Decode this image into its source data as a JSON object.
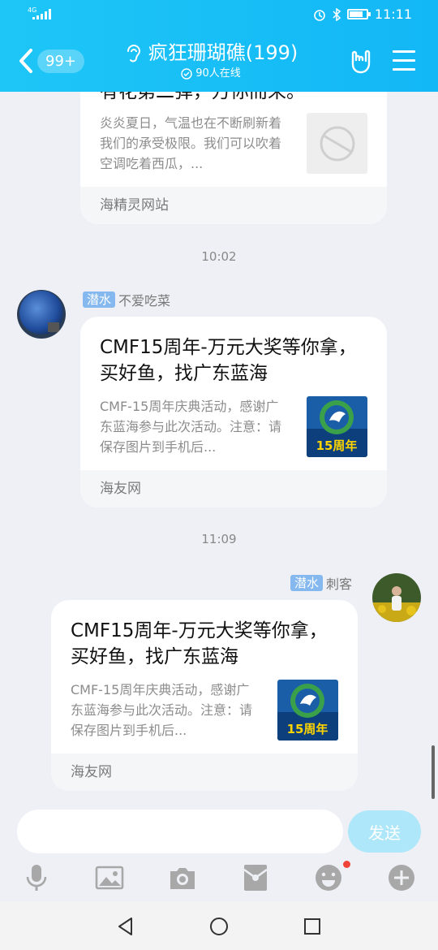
{
  "status_bar": {
    "network": "4G",
    "time": "11:11"
  },
  "header": {
    "back_badge": "99+",
    "group_name": "疯狂珊瑚礁(199)",
    "online_count": "90人在线"
  },
  "messages": [
    {
      "card": {
        "title": "有花第二弹，万你而来。",
        "desc": "炎炎夏日，气温也在不断刷新着我们的承受极限。我们可以吹着空调吃着西瓜，...",
        "source": "海精灵网站"
      }
    },
    {
      "time": "10:02",
      "sender_tag": "潜水",
      "sender_name": "不爱吃菜",
      "card": {
        "title": "CMF15周年-万元大奖等你拿，买好鱼，找广东蓝海",
        "desc": "CMF-15周年庆典活动，感谢广东蓝海参与此次活动。注意：请保存图片到手机后...",
        "thumb_text": "15周年",
        "source": "海友网"
      }
    },
    {
      "time": "11:09",
      "sender_tag": "潜水",
      "sender_name": "刺客",
      "card": {
        "title": "CMF15周年-万元大奖等你拿，买好鱼，找广东蓝海",
        "desc": "CMF-15周年庆典活动，感谢广东蓝海参与此次活动。注意：请保存图片到手机后...",
        "thumb_text": "15周年",
        "source": "海友网"
      }
    }
  ],
  "composer": {
    "input_value": "",
    "send_label": "发送"
  },
  "toolbar_icons": [
    "microphone-icon",
    "image-icon",
    "camera-icon",
    "red-packet-icon",
    "emoji-icon",
    "plus-icon"
  ],
  "colors": {
    "header": "#12b7f5",
    "send_button": "#aee7f9",
    "tag": "#85b8ee",
    "notification_dot": "#f0443a"
  }
}
